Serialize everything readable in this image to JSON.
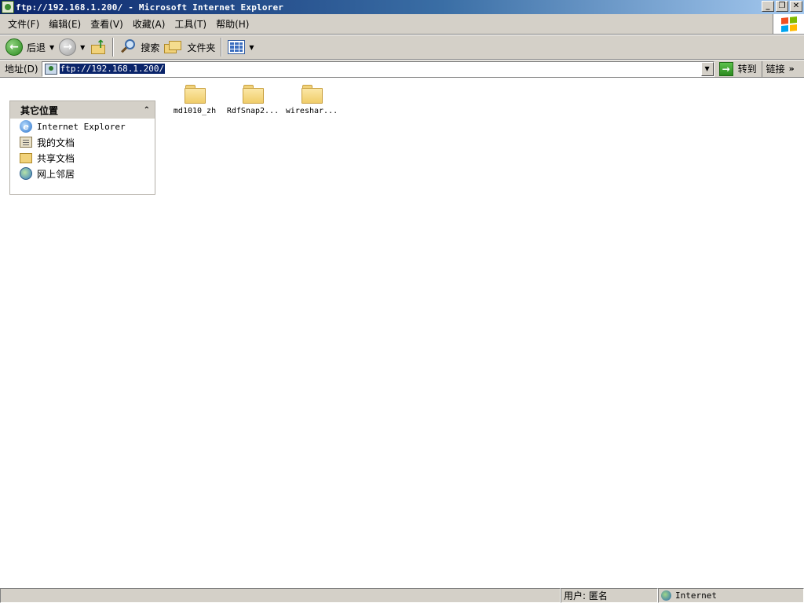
{
  "window": {
    "title": "ftp://192.168.1.200/ - Microsoft Internet Explorer",
    "minimize": "_",
    "restore": "❐",
    "close": "✕"
  },
  "menu": {
    "items": [
      "文件(F)",
      "编辑(E)",
      "查看(V)",
      "收藏(A)",
      "工具(T)",
      "帮助(H)"
    ]
  },
  "toolbar": {
    "back_label": "后退",
    "search_label": "搜索",
    "folders_label": "文件夹"
  },
  "address": {
    "label": "地址(D)",
    "url": "ftp://192.168.1.200/",
    "go_label": "转到",
    "links_label": "链接"
  },
  "taskpane": {
    "title": "其它位置",
    "places": [
      "Internet Explorer",
      "我的文档",
      "共享文档",
      "网上邻居"
    ]
  },
  "files": [
    "md1010_zh",
    "RdfSnap2...",
    "wireshar..."
  ],
  "status": {
    "user": "用户: 匿名",
    "zone": "Internet"
  },
  "colors": {
    "title_gradient_start": "#0a246a",
    "title_gradient_end": "#a6caf0",
    "chrome": "#d4d0c8",
    "selection": "#0a246a"
  }
}
